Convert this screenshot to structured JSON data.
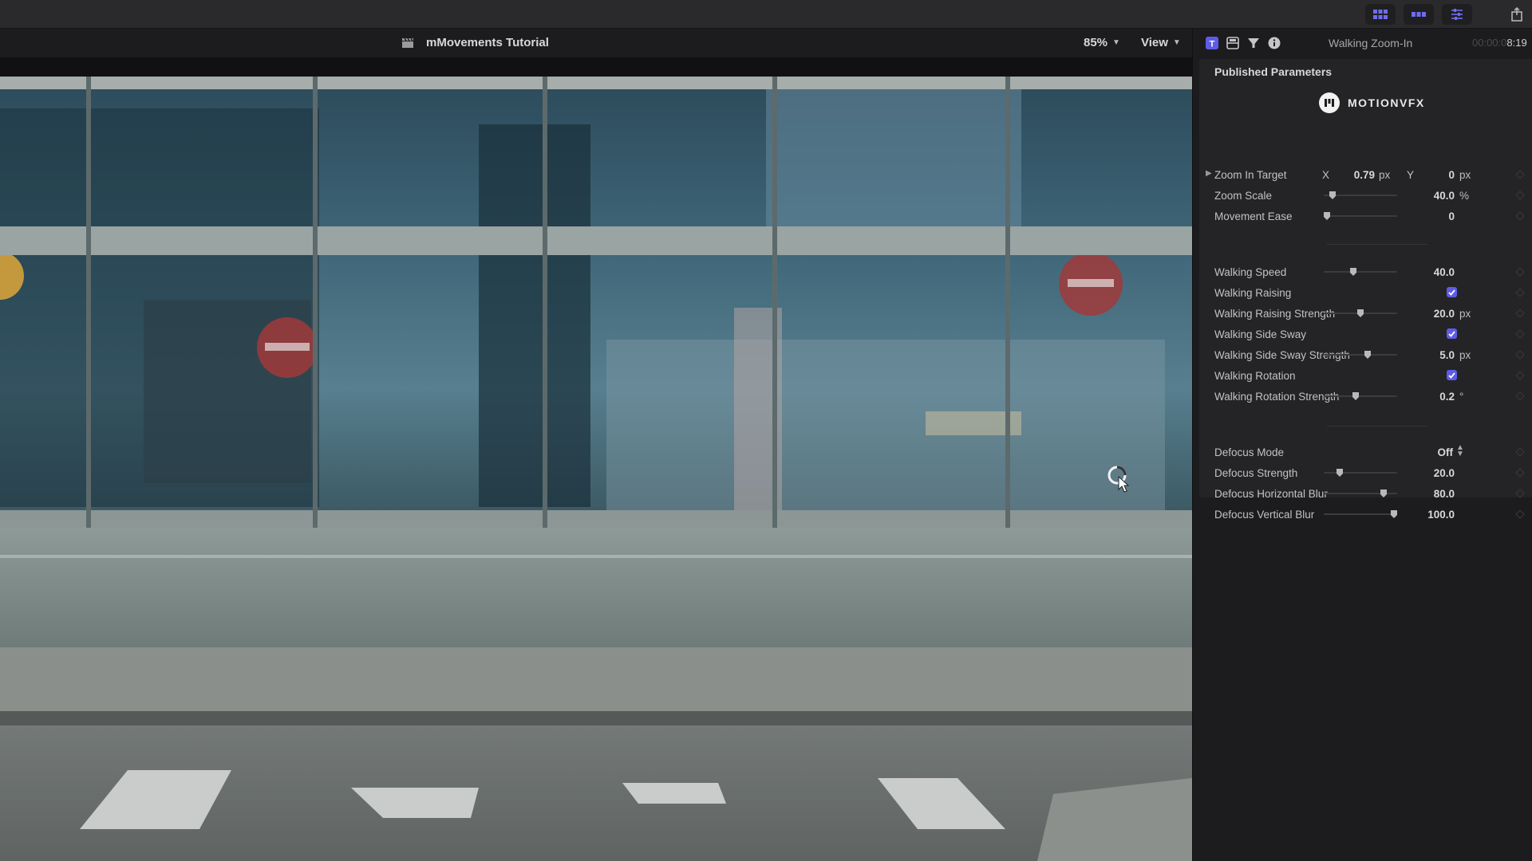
{
  "viewer": {
    "title": "mMovements Tutorial",
    "zoom": "85%",
    "view_label": "View"
  },
  "inspector": {
    "clip_name": "Walking Zoom-In",
    "timecode_prefix": "00:00:0",
    "timecode": "8:19",
    "section_title": "Published Parameters",
    "brand": "MOTIONVFX",
    "zoom_in_target": {
      "label": "Zoom In Target",
      "x_label": "X",
      "x_value": "0.79",
      "x_unit": "px",
      "y_label": "Y",
      "y_value": "0",
      "y_unit": "px"
    },
    "sliders": [
      {
        "id": "zoom-scale",
        "label": "Zoom Scale",
        "value": "40.0",
        "unit": "%",
        "fraction": 0.12
      },
      {
        "id": "movement-ease",
        "label": "Movement Ease",
        "value": "0",
        "unit": "",
        "fraction": 0.04
      },
      {
        "id": "walking-speed",
        "label": "Walking Speed",
        "value": "40.0",
        "unit": "",
        "fraction": 0.4
      },
      {
        "id": "walking-raising-strength",
        "label": "Walking Raising Strength",
        "value": "20.0",
        "unit": "px",
        "fraction": 0.5
      },
      {
        "id": "walking-side-sway-strength",
        "label": "Walking Side Sway Strength",
        "value": "5.0",
        "unit": "px",
        "fraction": 0.6
      },
      {
        "id": "walking-rotation-strength",
        "label": "Walking Rotation Strength",
        "value": "0.2",
        "unit": "°",
        "fraction": 0.44
      },
      {
        "id": "defocus-strength",
        "label": "Defocus Strength",
        "value": "20.0",
        "unit": "",
        "fraction": 0.22
      },
      {
        "id": "defocus-horizontal-blur",
        "label": "Defocus Horizontal Blur",
        "value": "80.0",
        "unit": "",
        "fraction": 0.82
      },
      {
        "id": "defocus-vertical-blur",
        "label": "Defocus Vertical Blur",
        "value": "100.0",
        "unit": "",
        "fraction": 0.96
      }
    ],
    "checkboxes": [
      {
        "id": "walking-raising",
        "label": "Walking Raising",
        "checked": true
      },
      {
        "id": "walking-side-sway",
        "label": "Walking Side Sway",
        "checked": true
      },
      {
        "id": "walking-rotation",
        "label": "Walking Rotation",
        "checked": true
      }
    ],
    "defocus_mode": {
      "label": "Defocus Mode",
      "value": "Off"
    }
  },
  "colors": {
    "accent": "#5e5ce6",
    "panel": "#242426",
    "background": "#1c1c1e"
  }
}
